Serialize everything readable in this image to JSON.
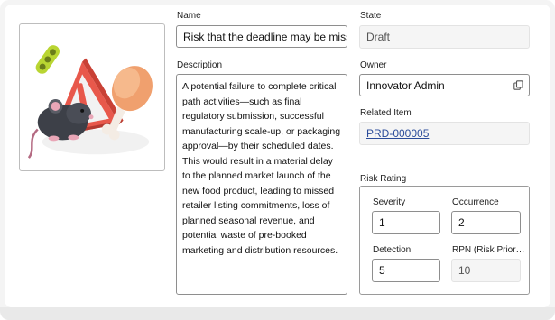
{
  "name": {
    "label": "Name",
    "value": "Risk that the deadline may be missed"
  },
  "state": {
    "label": "State",
    "value": "Draft"
  },
  "description": {
    "label": "Description",
    "value": "A potential failure to complete critical path activities—such as final regulatory submission, successful manufacturing scale-up, or packaging approval—by their scheduled dates. This would result in a material delay to the planned market launch of the new food product, leading to missed retailer listing commitments, loss of planned seasonal revenue, and potential waste of pre-booked marketing and distribution resources."
  },
  "owner": {
    "label": "Owner",
    "value": "Innovator Admin",
    "icon": "copy-icon"
  },
  "related_item": {
    "label": "Related Item",
    "value": "PRD-000005"
  },
  "risk_rating": {
    "title": "Risk Rating",
    "severity": {
      "label": "Severity",
      "value": "1"
    },
    "occurrence": {
      "label": "Occurrence",
      "value": "2"
    },
    "detection": {
      "label": "Detection",
      "value": "5"
    },
    "rpn": {
      "label": "RPN (Risk Prior…",
      "value": "10"
    }
  },
  "image": {
    "icon": "risk-warning-illustration-icon"
  },
  "colors": {
    "link": "#2b4c9a",
    "warning_red": "#e8584b",
    "readonly_bg": "#f5f5f5"
  }
}
